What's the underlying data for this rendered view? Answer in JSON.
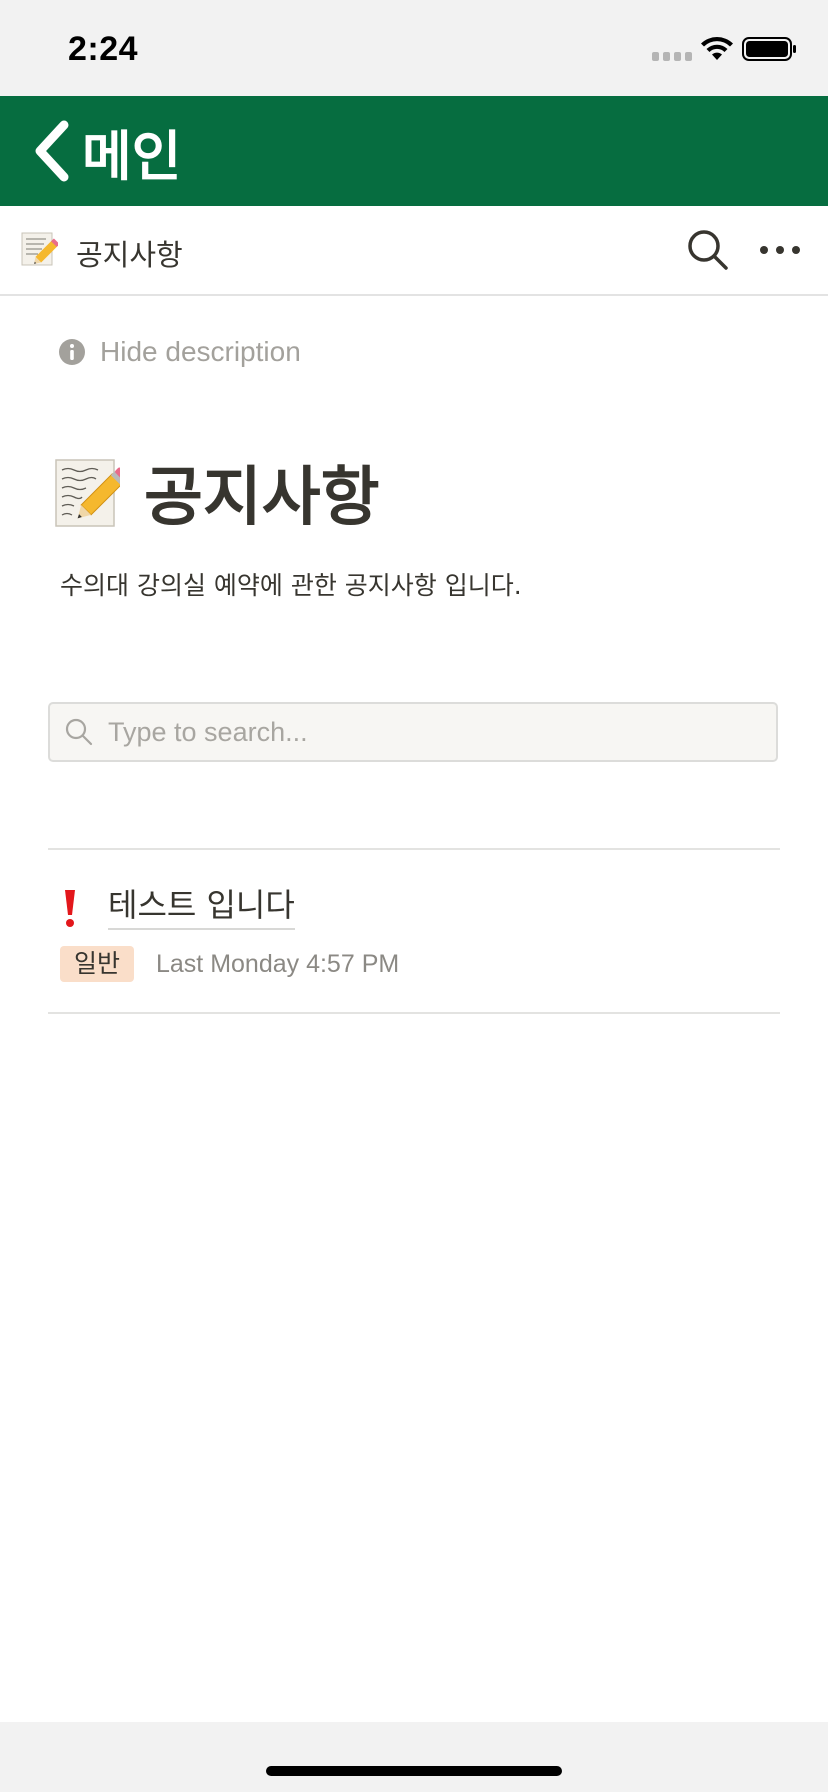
{
  "status_bar": {
    "time": "2:24"
  },
  "nav": {
    "back_label": "메인",
    "header_color": "#066d40"
  },
  "topbar": {
    "page_emoji": "memo-icon",
    "title": "공지사항"
  },
  "description_toggle": {
    "label": "Hide description"
  },
  "page": {
    "emoji": "memo-icon",
    "title": "공지사항",
    "description": "수의대 강의실 예약에 관한 공지사항 입니다."
  },
  "search": {
    "value": "",
    "placeholder": "Type to search..."
  },
  "items": [
    {
      "icon": "exclamation-icon",
      "title": "테스트 입니다",
      "tag": "일반",
      "tag_color": "#fadec9",
      "date": "Last Monday 4:57 PM"
    }
  ]
}
